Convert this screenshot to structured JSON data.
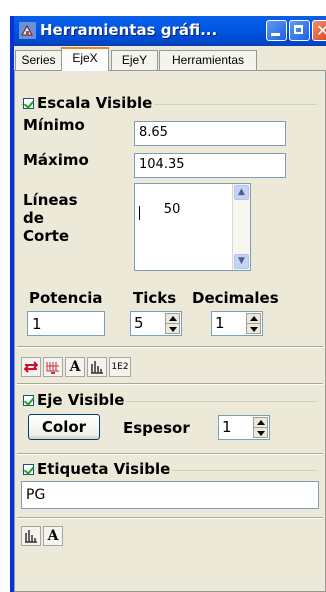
{
  "window": {
    "title": "Herramientas gráfi..."
  },
  "tabs": [
    {
      "label": "Series"
    },
    {
      "label": "EjeX"
    },
    {
      "label": "EjeY"
    },
    {
      "label": "Herramientas"
    }
  ],
  "escala": {
    "checkbox_label": "Escala Visible",
    "checked": true,
    "minimo_label": "Mínimo",
    "minimo_value": "8.65",
    "maximo_label": "Máximo",
    "maximo_value": "104.35",
    "lineas_label_1": "Líneas",
    "lineas_label_2": "de",
    "lineas_label_3": "Corte",
    "lineas_value": "50",
    "potencia_label": "Potencia",
    "potencia_value": "1",
    "ticks_label": "Ticks",
    "ticks_value": "5",
    "decimales_label": "Decimales",
    "decimales_value": "1"
  },
  "toolbar1": {
    "icons": [
      "axis-arrows-icon",
      "grid-icon",
      "font-A-icon",
      "bars-icon",
      "exponent-1E2-icon"
    ],
    "font_label": "A",
    "exp_label": "1E2"
  },
  "eje": {
    "checkbox_label": "Eje Visible",
    "checked": true,
    "color_button": "Color",
    "espesor_label": "Espesor",
    "espesor_value": "1"
  },
  "etiqueta": {
    "checkbox_label": "Etiqueta Visible",
    "checked": true,
    "value": "PG",
    "font_label": "A"
  },
  "colors": {
    "titlebar": "#0058e6",
    "tab_accent": "#e68b2c",
    "panel": "#ece9d8"
  }
}
